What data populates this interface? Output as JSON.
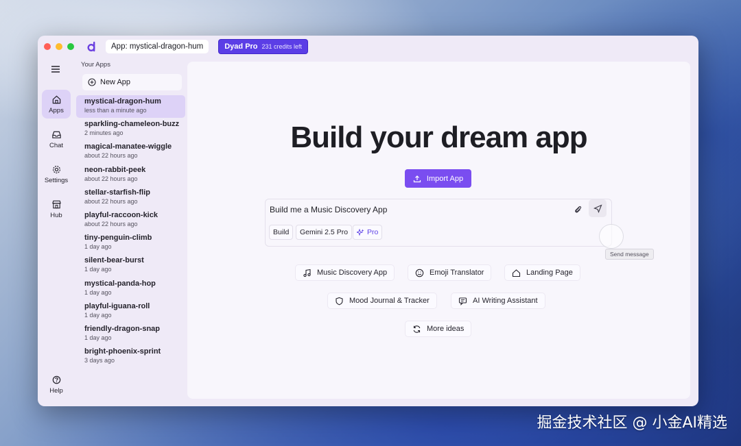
{
  "titlebar": {
    "app_label": "App: mystical-dragon-hum",
    "plan_label": "Dyad Pro",
    "credits": "231 credits left"
  },
  "rail": {
    "items": [
      {
        "label": "Apps",
        "icon": "home-icon"
      },
      {
        "label": "Chat",
        "icon": "inbox-icon"
      },
      {
        "label": "Settings",
        "icon": "gear-icon"
      },
      {
        "label": "Hub",
        "icon": "store-icon"
      }
    ],
    "help": "Help"
  },
  "sidebar": {
    "heading": "Your Apps",
    "new_app": "New App",
    "apps": [
      {
        "name": "mystical-dragon-hum",
        "time": "less than a minute ago"
      },
      {
        "name": "sparkling-chameleon-buzz",
        "time": "2 minutes ago"
      },
      {
        "name": "magical-manatee-wiggle",
        "time": "about 22 hours ago"
      },
      {
        "name": "neon-rabbit-peek",
        "time": "about 22 hours ago"
      },
      {
        "name": "stellar-starfish-flip",
        "time": "about 22 hours ago"
      },
      {
        "name": "playful-raccoon-kick",
        "time": "about 22 hours ago"
      },
      {
        "name": "tiny-penguin-climb",
        "time": "1 day ago"
      },
      {
        "name": "silent-bear-burst",
        "time": "1 day ago"
      },
      {
        "name": "mystical-panda-hop",
        "time": "1 day ago"
      },
      {
        "name": "playful-iguana-roll",
        "time": "1 day ago"
      },
      {
        "name": "friendly-dragon-snap",
        "time": "1 day ago"
      },
      {
        "name": "bright-phoenix-sprint",
        "time": "3 days ago"
      }
    ]
  },
  "main": {
    "hero": "Build your dream app",
    "import_label": "Import App",
    "chat_value": "Build me a Music Discovery App",
    "chips": {
      "mode": "Build",
      "model": "Gemini 2.5 Pro",
      "pro": "Pro"
    },
    "send_tooltip": "Send message",
    "ideas": [
      {
        "label": "Music Discovery App",
        "icon": "music-note-icon"
      },
      {
        "label": "Emoji Translator",
        "icon": "smiley-icon"
      },
      {
        "label": "Landing Page",
        "icon": "house-icon"
      },
      {
        "label": "Mood Journal & Tracker",
        "icon": "shield-icon"
      },
      {
        "label": "AI Writing Assistant",
        "icon": "message-icon"
      },
      {
        "label": "More ideas",
        "icon": "refresh-icon"
      }
    ]
  },
  "watermark": "掘金技术社区 @ 小金AI精选",
  "colors": {
    "accent": "#7a4df0",
    "pro": "#5b3ee6",
    "active": "#ddd2f7"
  }
}
